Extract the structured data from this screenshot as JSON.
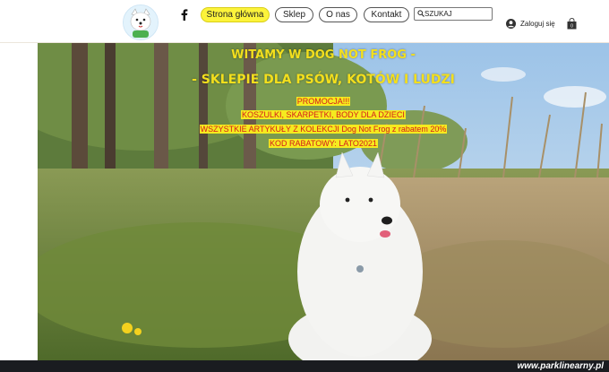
{
  "header": {
    "nav": [
      {
        "label": "Strona główna",
        "active": true
      },
      {
        "label": "Sklep"
      },
      {
        "label": "O nas"
      },
      {
        "label": "Kontakt"
      }
    ],
    "search": {
      "value": "SZUKAJ"
    },
    "login_label": "Zaloguj się",
    "cart_count": "0",
    "logo_text": "DOG"
  },
  "hero": {
    "headline_1": "WITAMY W  DOG NOT FROG  -",
    "headline_2": "- SKLEPIE DLA PSÓW, KOTÓW I LUDZI",
    "promo": [
      "PROMOCJA!!!",
      "KOSZULKI, SKARPETKI, BODY DLA DZIECI",
      "WSZYSTKIE ARTYKUŁY Z KOLEKCJI Dog Not Frog z rabatem 20%",
      "KOD RABATOWY: LATO2021"
    ]
  },
  "watermark": "www.parklinearny.pl",
  "colors": {
    "accent_yellow": "#fcf33b",
    "promo_red": "#d41c1c",
    "headline_yellow": "#f3df1d"
  }
}
